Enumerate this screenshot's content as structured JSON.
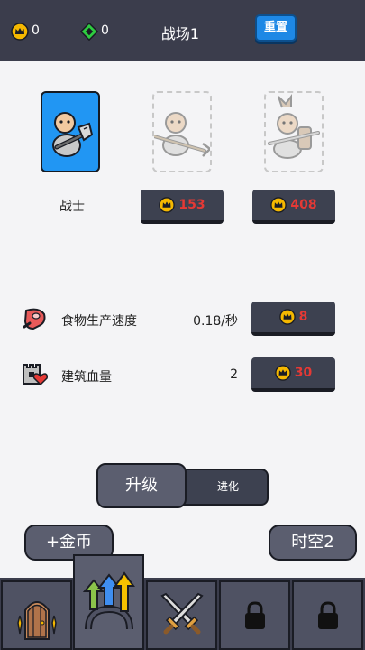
{
  "header": {
    "coins": "0",
    "gems": "0",
    "title": "战场1",
    "reset_label": "重置"
  },
  "units": [
    {
      "name": "战士",
      "state": "selected",
      "icon": "warrior-icon"
    },
    {
      "state": "locked",
      "icon": "spearman-icon",
      "cost": "153"
    },
    {
      "state": "locked",
      "icon": "knight-icon",
      "cost": "408"
    }
  ],
  "stats": [
    {
      "icon": "meat-icon",
      "label": "食物生产速度",
      "value": "0.18/秒",
      "cost": "8"
    },
    {
      "icon": "castle-heart-icon",
      "label": "建筑血量",
      "value": "2",
      "cost": "30"
    }
  ],
  "tabs": {
    "upgrade": "升级",
    "evolve": "进化"
  },
  "actions": {
    "add_gold": "+金币",
    "timespace": "时空2"
  },
  "nav": [
    {
      "icon": "door-icon",
      "state": "normal"
    },
    {
      "icon": "upgrade-arrows-icon",
      "state": "active"
    },
    {
      "icon": "crossed-swords-icon",
      "state": "normal"
    },
    {
      "icon": "lock-icon",
      "state": "locked"
    },
    {
      "icon": "lock-icon",
      "state": "locked"
    }
  ],
  "colors": {
    "header_bg": "#3b3d4c",
    "selected_card": "#2196f3",
    "cost_text": "#e53935",
    "coin_gold": "#f5b800",
    "gem_green": "#2ecc40"
  }
}
